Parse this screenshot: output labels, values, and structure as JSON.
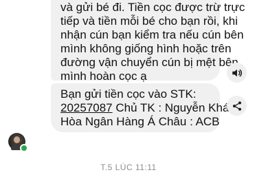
{
  "messages": [
    {
      "lines": [
        "và gửi bé đi. Tiền cọc được trừ trực",
        "tiếp và tiền mỗi bé cho bạn rồi, khi",
        "nhận cún bạn kiểm tra nếu cún bên",
        "mình không giống hình hoặc trên",
        "đường vận chuyển cún bị mệt bên",
        "mình hoàn cọc ạ"
      ]
    },
    {
      "line1": "Bạn gửi tiền cọc vào STK:",
      "account_number": "20257087",
      "line2_rest": " Chủ TK : Nguyễn Khánh",
      "line3": "Hòa Ngân Hàng Á Châu : ACB"
    }
  ],
  "actions": {
    "audio_icon": "speaker-icon",
    "share_icon": "share-icon"
  },
  "status": {
    "online_color": "#31a24c"
  },
  "timestamp": "T.5 LÚC 11:11"
}
